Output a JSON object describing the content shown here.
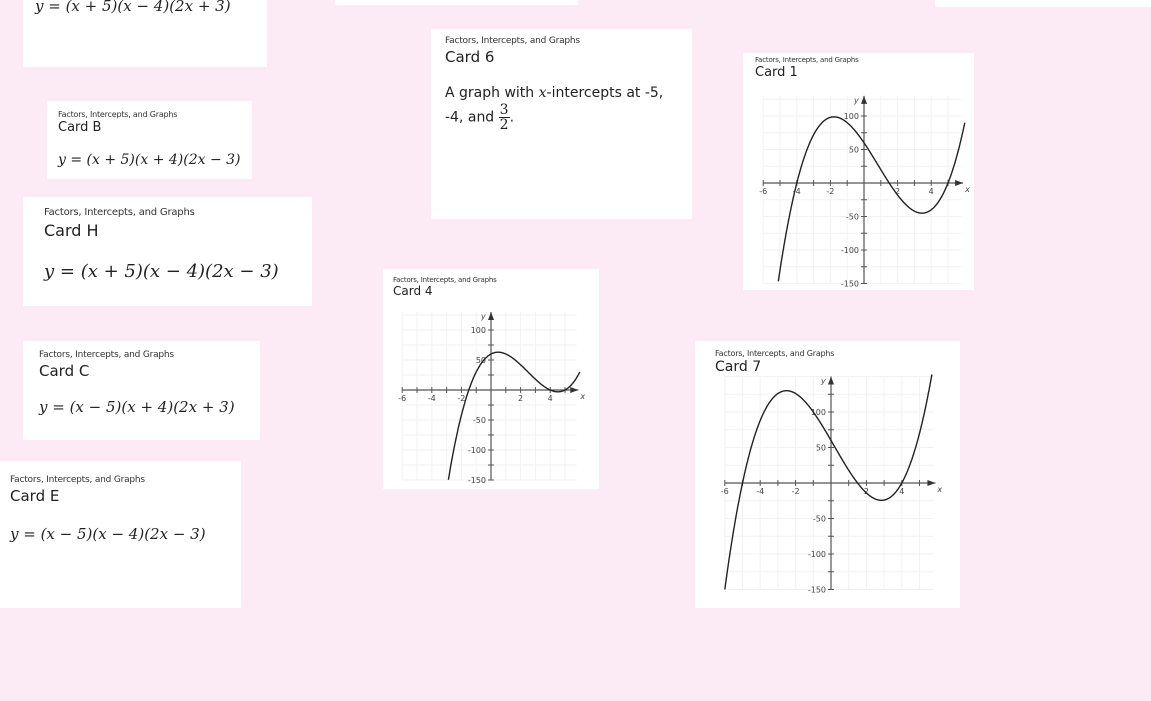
{
  "background_color": "#fcebf5",
  "cards": {
    "top_partial": {
      "equation": "y = (x + 5)(x − 4)(2x + 3)"
    },
    "card_b": {
      "header": "Factors, Intercepts, and Graphs",
      "title": "Card B",
      "equation": "y = (x + 5)(x + 4)(2x − 3)"
    },
    "card_h": {
      "header": "Factors, Intercepts, and Graphs",
      "title": "Card H",
      "equation": "y = (x + 5)(x − 4)(2x − 3)"
    },
    "card_c": {
      "header": "Factors, Intercepts, and Graphs",
      "title": "Card C",
      "equation": "y = (x − 5)(x + 4)(2x + 3)"
    },
    "card_e": {
      "header": "Factors, Intercepts, and Graphs",
      "title": "Card E",
      "equation": "y = (x − 5)(x − 4)(2x − 3)"
    },
    "card_6": {
      "header": "Factors, Intercepts, and Graphs",
      "title": "Card 6",
      "text_line1_a": "A graph with ",
      "text_var": "x",
      "text_line1_b": "-intercepts at -5,",
      "text_line2": "-4, and ",
      "frac_num": "3",
      "frac_den": "2",
      "text_end": "."
    },
    "card_1": {
      "header": "Factors, Intercepts, and Graphs",
      "title": "Card 1"
    },
    "card_4": {
      "header": "Factors, Intercepts, and Graphs",
      "title": "Card 4"
    },
    "card_7": {
      "header": "Factors, Intercepts, and Graphs",
      "title": "Card 7"
    }
  },
  "chart_data": [
    {
      "card": "Card 1",
      "type": "line",
      "xlabel": "x",
      "ylabel": "y",
      "xlim": [
        -6,
        6
      ],
      "ylim": [
        -150,
        130
      ],
      "x_tick_labels": [
        "-6",
        "-4",
        "-2",
        "2",
        "4"
      ],
      "y_tick_labels": [
        "100",
        "50",
        "-50",
        "-100",
        "-150"
      ],
      "x_intercepts": [
        -4,
        1.5,
        5
      ],
      "y_intercept": 60
    },
    {
      "card": "Card 4",
      "type": "line",
      "xlabel": "x",
      "ylabel": "y",
      "xlim": [
        -6,
        6
      ],
      "ylim": [
        -150,
        130
      ],
      "x_tick_labels": [
        "-6",
        "-4",
        "-2",
        "2",
        "4"
      ],
      "y_tick_labels": [
        "100",
        "50",
        "-50",
        "-100",
        "-150"
      ],
      "x_intercepts": [
        -1.5,
        4,
        5
      ],
      "y_intercept": 60
    },
    {
      "card": "Card 7",
      "type": "line",
      "xlabel": "x",
      "ylabel": "y",
      "xlim": [
        -6,
        6
      ],
      "ylim": [
        -150,
        150
      ],
      "x_tick_labels": [
        "-6",
        "-4",
        "-2",
        "2",
        "4"
      ],
      "y_tick_labels": [
        "100",
        "50",
        "-50",
        "-100",
        "-150"
      ],
      "x_intercepts": [
        -5,
        1.5,
        4
      ],
      "y_intercept": 60
    }
  ]
}
